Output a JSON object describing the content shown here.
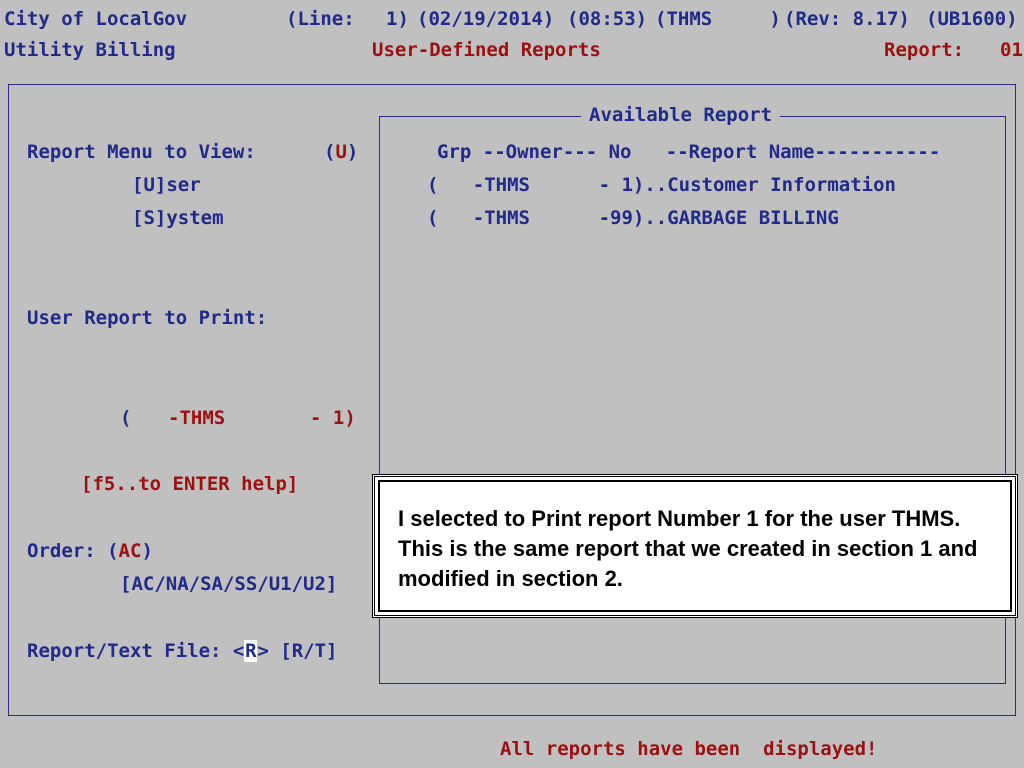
{
  "header": {
    "city": "City of LocalGov",
    "line_label": "(Line:",
    "line_value": "1)",
    "date": "(02/19/2014)",
    "time": "(08:53)",
    "user": "(THMS     )",
    "rev": "(Rev: 8.17)",
    "module_code": "(UB1600)",
    "app_name": "Utility Billing",
    "screen_title": "User-Defined Reports",
    "report_label": "Report:",
    "report_value": "01"
  },
  "left": {
    "menu_label": "Report Menu to View:",
    "menu_value_open": "(",
    "menu_value": "U",
    "menu_value_close": ")",
    "opt_user": "[U]ser",
    "opt_system": "[S]ystem",
    "print_label": "User Report to Print:",
    "print_open": "(",
    "print_owner": "-THMS",
    "print_no": "- 1)",
    "help": "[f5..to ENTER help]",
    "order_label": "Order:",
    "order_open": "(",
    "order_value": "AC",
    "order_close": ")",
    "order_options": "[AC/NA/SA/SS/U1/U2]",
    "file_label": "Report/Text File:",
    "file_open": "<",
    "file_value": "R",
    "file_close": ">",
    "file_options": "[R/T]"
  },
  "report_panel": {
    "title": "Available Report",
    "header": "Grp --Owner--- No   --Report Name-----------",
    "rows": [
      "(   -THMS      - 1)..Customer Information",
      "(   -THMS      -99)..GARBAGE BILLING"
    ]
  },
  "callout": {
    "text": "I selected to Print report Number 1 for the user THMS.   This is the same report that we created in section 1 and modified in section 2."
  },
  "status": {
    "message": "All reports have been  displayed!"
  }
}
